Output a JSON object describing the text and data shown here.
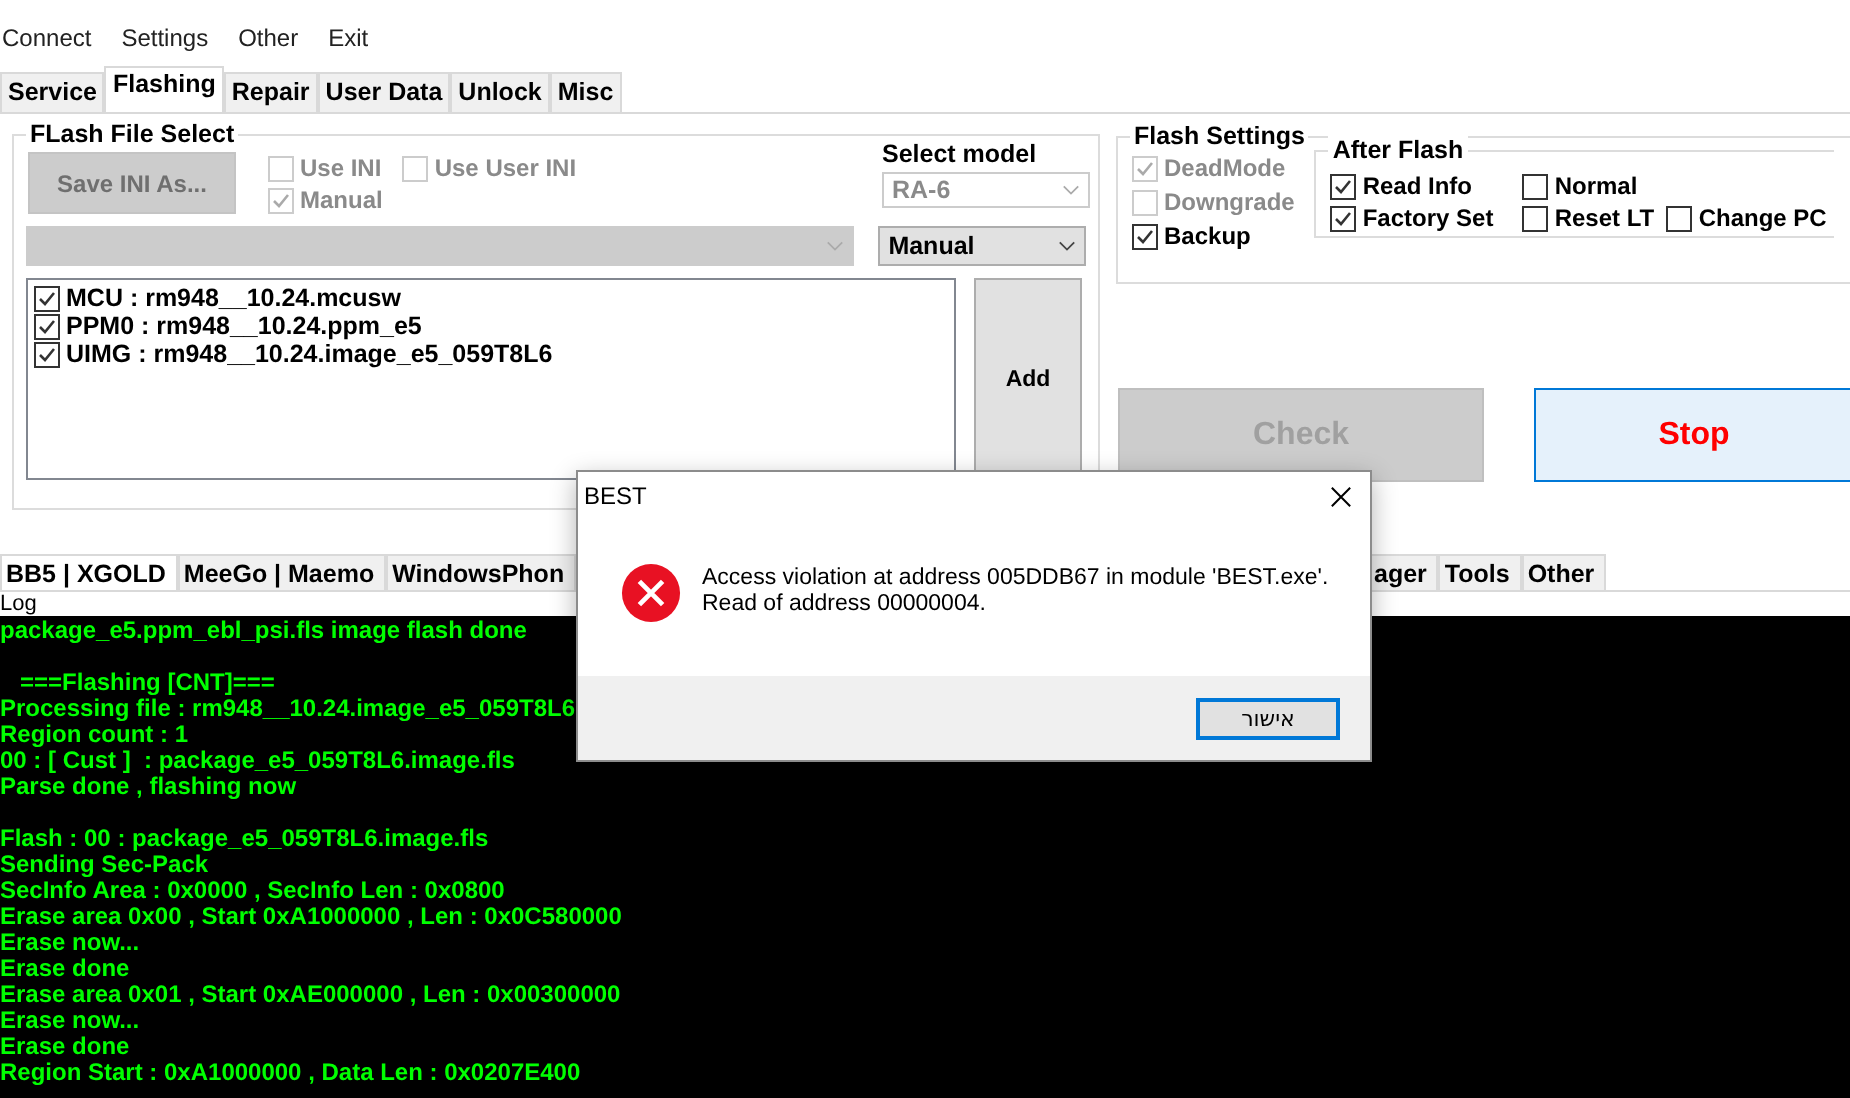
{
  "menu": [
    "Connect",
    "Settings",
    "Other",
    "Exit"
  ],
  "tabs": [
    {
      "label": "Service",
      "selected": false
    },
    {
      "label": "Flashing",
      "selected": true
    },
    {
      "label": "Repair",
      "selected": false
    },
    {
      "label": "User Data",
      "selected": false
    },
    {
      "label": "Unlock",
      "selected": false
    },
    {
      "label": "Misc",
      "selected": false
    }
  ],
  "flash_file_select": {
    "title": "FLash File Select",
    "save_button": {
      "label": "Save INI As...",
      "disabled": true
    },
    "checkboxes": [
      {
        "label": "Use INI",
        "checked": false,
        "disabled": true
      },
      {
        "label": "Use User INI",
        "checked": false,
        "disabled": true
      },
      {
        "label": "Manual",
        "checked": true,
        "disabled": true
      }
    ],
    "file_dropdown": {
      "disabled": true
    },
    "files": [
      {
        "label": "MCU  : rm948__10.24.mcusw",
        "checked": true
      },
      {
        "label": "PPM0 : rm948__10.24.ppm_e5",
        "checked": true
      },
      {
        "label": "UIMG : rm948__10.24.image_e5_059T8L6",
        "checked": true
      }
    ],
    "add_button": "Add"
  },
  "select_model": {
    "label": "Select model",
    "model": {
      "value": "RA-6",
      "disabled": true
    },
    "mode": {
      "value": "Manual",
      "disabled": false
    }
  },
  "flash_settings": {
    "title": "Flash Settings",
    "options": [
      {
        "label": "DeadMode",
        "checked": true,
        "disabled": true
      },
      {
        "label": "Downgrade",
        "checked": false,
        "disabled": true
      },
      {
        "label": "Backup",
        "checked": true,
        "disabled": false
      }
    ],
    "after_flash": {
      "title": "After Flash",
      "rows": [
        [
          {
            "label": "Read Info",
            "checked": true
          },
          {
            "label": "Normal",
            "checked": false
          }
        ],
        [
          {
            "label": "Factory Set",
            "checked": true
          },
          {
            "label": "Reset LT",
            "checked": false
          },
          {
            "label": "Change PC",
            "checked": false
          }
        ]
      ]
    }
  },
  "check_button": {
    "label": "Check",
    "disabled": true
  },
  "stop_button": {
    "label": "Stop",
    "disabled": false
  },
  "lower_tabs": [
    {
      "label": "BB5 | XGOLD",
      "selected": true
    },
    {
      "label": "MeeGo | Maemo",
      "selected": false
    },
    {
      "label": "WindowsPhon",
      "selected": false
    },
    {
      "label": "ager",
      "selected": false
    },
    {
      "label": "Tools",
      "selected": false
    },
    {
      "label": "Other",
      "selected": false
    }
  ],
  "log": {
    "title": "Log",
    "lines": [
      {
        "text": "package_e5.ppm_ebl_psi.fls image flash done",
        "blank_before": false
      },
      {
        "text": "   ===Flashing [CNT]===",
        "blank_before": true
      },
      {
        "text": "Processing file : rm948__10.24.image_e5_059T8L6",
        "blank_before": false
      },
      {
        "text": "Region count : 1",
        "blank_before": false
      },
      {
        "text": "00 : [ Cust ]  : package_e5_059T8L6.image.fls",
        "blank_before": false
      },
      {
        "text": "Parse done , flashing now",
        "blank_before": false
      },
      {
        "text": "Flash : 00 : package_e5_059T8L6.image.fls",
        "blank_before": true
      },
      {
        "text": "Sending Sec-Pack",
        "blank_before": false
      },
      {
        "text": "SecInfo Area : 0x0000 , SecInfo Len : 0x0800",
        "blank_before": false
      },
      {
        "text": "Erase area 0x00 , Start 0xA1000000 , Len : 0x0C580000",
        "blank_before": false
      },
      {
        "text": "Erase now...",
        "blank_before": false
      },
      {
        "text": "Erase done",
        "blank_before": false
      },
      {
        "text": "Erase area 0x01 , Start 0xAE000000 , Len : 0x00300000",
        "blank_before": false
      },
      {
        "text": "Erase now...",
        "blank_before": false
      },
      {
        "text": "Erase done",
        "blank_before": false
      },
      {
        "text": "Region Start : 0xA1000000 , Data Len : 0x0207E400",
        "blank_before": false
      }
    ]
  },
  "dialog": {
    "title": "BEST",
    "message": [
      "Access violation at address 005DDB67 in module 'BEST.exe'.",
      "Read of address 00000004."
    ],
    "ok_button": "אישור"
  }
}
